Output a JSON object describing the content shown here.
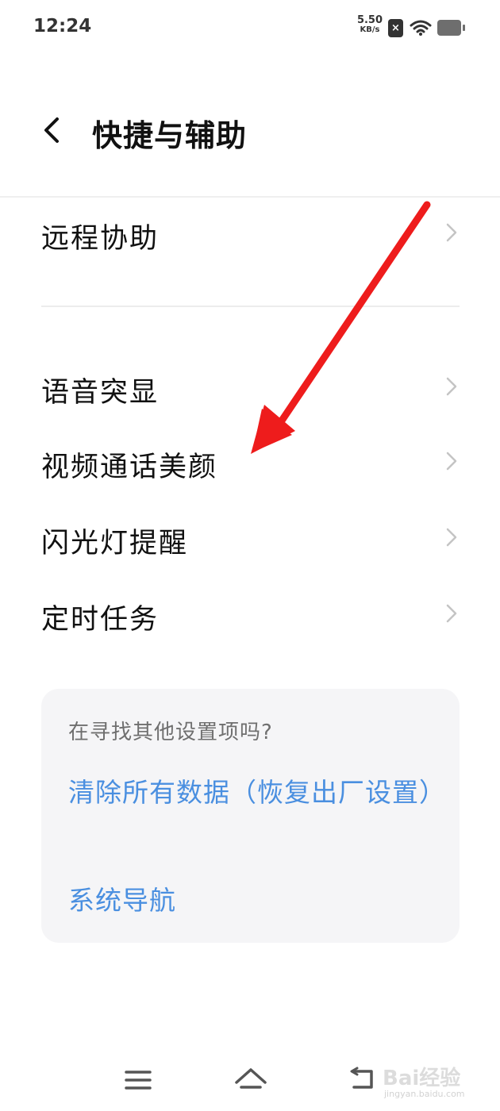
{
  "status_bar": {
    "time": "12:24",
    "net_speed_value": "5.50",
    "net_speed_unit": "KB/s",
    "icons": [
      "sim-x-icon",
      "wifi-icon",
      "battery-icon"
    ]
  },
  "header": {
    "title": "快捷与辅助",
    "back_icon": "back-chevron-icon"
  },
  "menu": {
    "items": [
      {
        "label": "远程协助"
      },
      {
        "label": "语音突显"
      },
      {
        "label": "视频通话美颜"
      },
      {
        "label": "闪光灯提醒"
      },
      {
        "label": "定时任务"
      }
    ]
  },
  "suggestion_card": {
    "question": "在寻找其他设置项吗?",
    "links": [
      {
        "label": "清除所有数据（恢复出厂设置）"
      },
      {
        "label": "系统导航"
      }
    ]
  },
  "annotation": {
    "arrow_color": "#ee1c1c",
    "points_to": "视频通话美颜"
  },
  "nav_bar": {
    "icons": [
      "menu-icon",
      "home-icon",
      "back-icon"
    ]
  },
  "watermark": {
    "text": "Bai经验",
    "sub": "jingyan.baidu.com"
  },
  "colors": {
    "link": "#4a8fe0",
    "card_bg": "#f5f5f7",
    "text": "#111111"
  }
}
